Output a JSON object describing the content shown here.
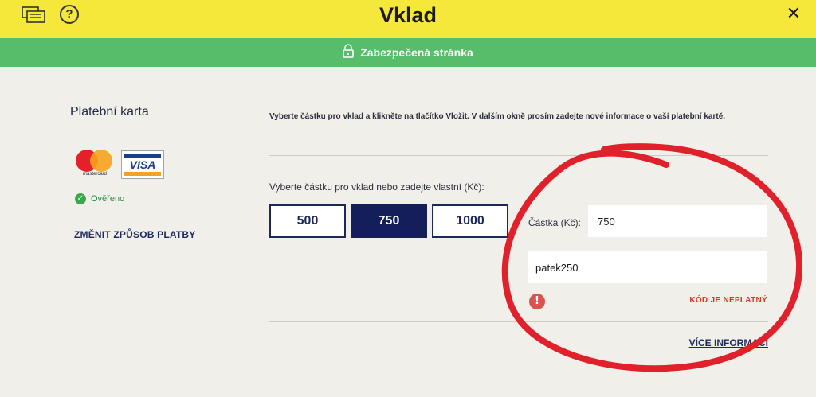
{
  "header": {
    "title": "Vklad",
    "close_glyph": "✕",
    "help_glyph": "?",
    "icons": [
      "chat-icon",
      "help-icon",
      "close-icon"
    ]
  },
  "secure_bar": {
    "text": "Zabezpečená stránka",
    "icon": "lock-icon",
    "color": "#58bd6a"
  },
  "payment": {
    "title": "Platební karta",
    "mastercard_text": "mastercard",
    "visa_text": "VISA",
    "verified_text": "Ověřeno",
    "change_link": "ZMĚNIT ZPŮSOB PLATBY"
  },
  "deposit": {
    "instructions": "Vyberte částku pro vklad a klikněte na tlačítko Vložit. V dalším okně prosím zadejte nové informace o vaší platební kartě.",
    "amount_prompt": "Vyberte částku pro vklad nebo zadejte vlastní (Kč):",
    "amount_options": [
      "500",
      "750",
      "1000"
    ],
    "selected_amount": "750",
    "amount_label": "Částka (Kč):",
    "amount_value": "750",
    "code_value": "patek250",
    "error_text": "KÓD JE NEPLATNÝ",
    "more_info_link": "VÍCE INFORMACÍ"
  },
  "colors": {
    "header_bg": "#f6e83a",
    "accent_navy": "#141f5a",
    "error_red": "#d03a2e",
    "annotation_red": "#e0202a"
  }
}
